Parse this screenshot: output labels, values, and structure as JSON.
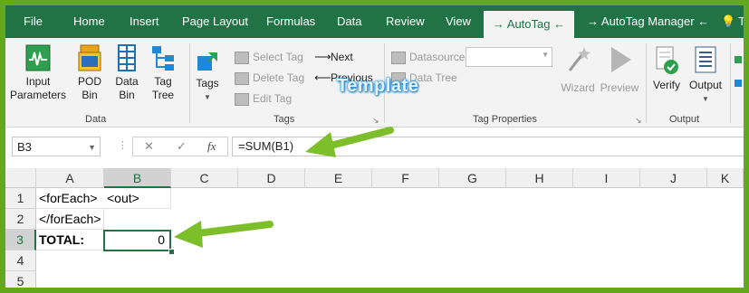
{
  "tabs": [
    {
      "label": "File",
      "active": false
    },
    {
      "label": "Home",
      "active": false
    },
    {
      "label": "Insert",
      "active": false
    },
    {
      "label": "Page Layout",
      "active": false
    },
    {
      "label": "Formulas",
      "active": false
    },
    {
      "label": "Data",
      "active": false
    },
    {
      "label": "Review",
      "active": false
    },
    {
      "label": "View",
      "active": false
    },
    {
      "label": "→ AutoTag ←",
      "active": true
    },
    {
      "label": "→ AutoTag Manager ←",
      "active": false
    },
    {
      "label": "T",
      "active": false
    }
  ],
  "ribbon": {
    "data_group": {
      "label": "Data",
      "buttons": [
        {
          "label1": "Input",
          "label2": "Parameters"
        },
        {
          "label1": "POD",
          "label2": "Bin"
        },
        {
          "label1": "Data",
          "label2": "Bin"
        },
        {
          "label1": "Tag",
          "label2": "Tree"
        }
      ]
    },
    "tags_group": {
      "label": "Tags",
      "tags_button": "Tags",
      "select_tag": "Select Tag",
      "delete_tag": "Delete Tag",
      "edit_tag": "Edit Tag",
      "next": "Next",
      "previous": "Previous"
    },
    "tag_properties_group": {
      "label": "Tag Properties",
      "datasource": "Datasource",
      "data_tree": "Data Tree",
      "wizard": "Wizard",
      "preview": "Preview"
    },
    "output_group": {
      "label": "Output",
      "verify": "Verify",
      "output": "Output"
    }
  },
  "formula_bar": {
    "name_box": "B3",
    "cancel_glyph": "✕",
    "enter_glyph": "✓",
    "fx_glyph": "fx",
    "formula": "=SUM(B1)"
  },
  "grid": {
    "columns": [
      "A",
      "B",
      "C",
      "D",
      "E",
      "F",
      "G",
      "H",
      "I",
      "J",
      "K"
    ],
    "rows": [
      "1",
      "2",
      "3",
      "4",
      "5"
    ],
    "cells": {
      "A1": "<forEach>",
      "B1": "<out>",
      "A2": "</forEach>",
      "A3": "TOTAL:",
      "B3": "0"
    },
    "selected_cell": "B3"
  },
  "annotations": {
    "template_label": "Template",
    "arrow_color": "#7cbf2a"
  },
  "colors": {
    "excel_green": "#217346",
    "frame_green": "#63a81f"
  }
}
